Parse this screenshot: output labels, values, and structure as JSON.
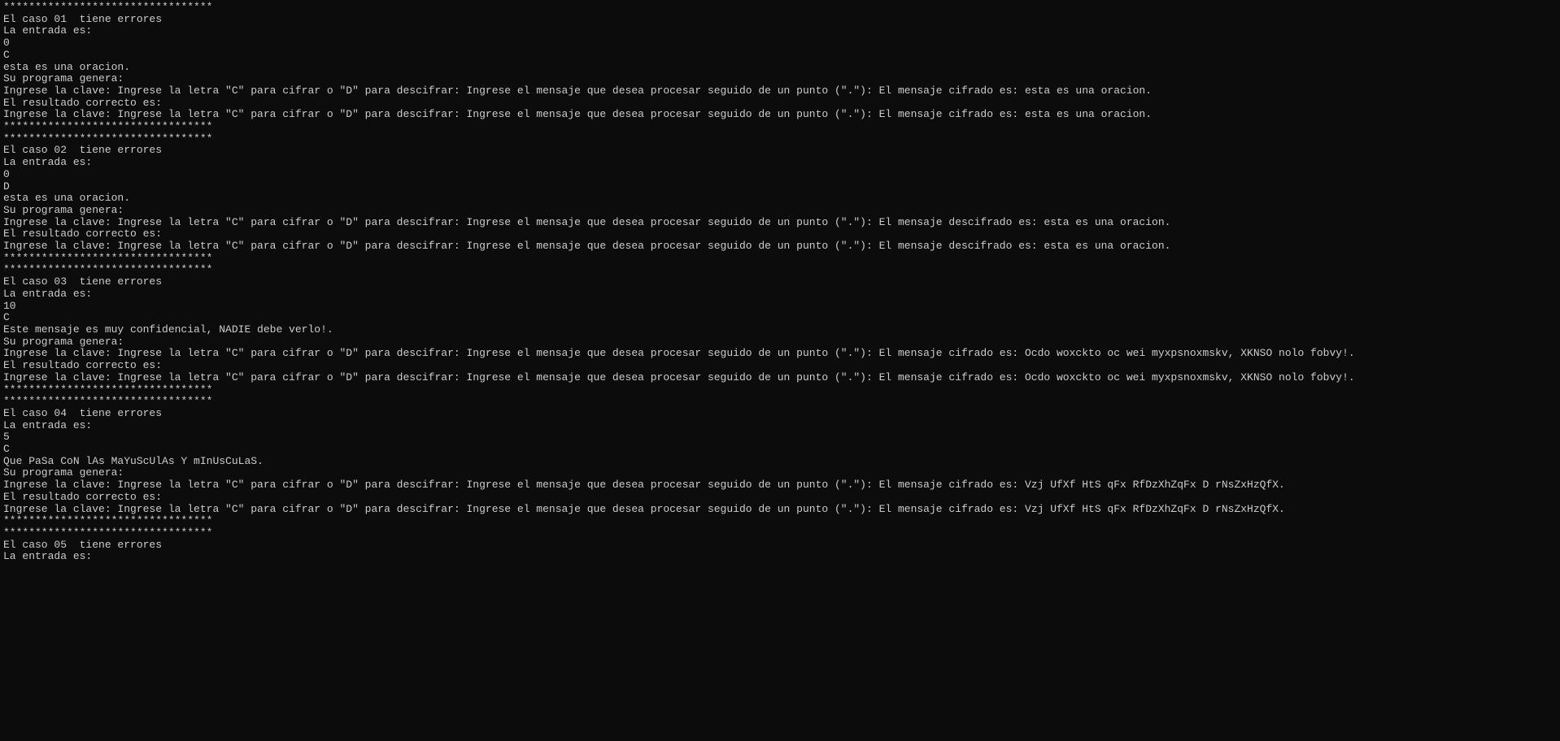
{
  "separator": "*********************************",
  "labels": {
    "caso_prefix": "El caso ",
    "caso_suffix": "  tiene errores",
    "entrada": "La entrada es:",
    "programa_genera": "Su programa genera:",
    "resultado_correcto": "El resultado correcto es:",
    "prompt_prefix": "Ingrese la clave: Ingrese la letra \"C\" para cifrar o \"D\" para descifrar: Ingrese el mensaje que desea procesar seguido de un punto (\".\"): El mensaje ",
    "cifrado": "cifrado es: ",
    "descifrado": "descifrado es: "
  },
  "cases": [
    {
      "num": "01",
      "input": [
        "0",
        "C",
        "esta es una oracion."
      ],
      "mode": "cifrado",
      "output": "esta es una oracion.",
      "expected": "esta es una oracion."
    },
    {
      "num": "02",
      "input": [
        "0",
        "D",
        "esta es una oracion."
      ],
      "mode": "descifrado",
      "output": "esta es una oracion.",
      "expected": "esta es una oracion."
    },
    {
      "num": "03",
      "input": [
        "10",
        "C",
        "Este mensaje es muy confidencial, NADIE debe verlo!."
      ],
      "mode": "cifrado",
      "output": "Ocdo woxckto oc wei myxpsnoxmskv, XKNSO nolo fobvy!.",
      "expected": "Ocdo woxckto oc wei myxpsnoxmskv, XKNSO nolo fobvy!."
    },
    {
      "num": "04",
      "input": [
        "5",
        "C",
        "Que PaSa CoN lAs MaYuScUlAs Y mInUsCuLaS."
      ],
      "mode": "cifrado",
      "output": "Vzj UfXf HtS qFx RfDzXhZqFx D rNsZxHzQfX.",
      "expected": "Vzj UfXf HtS qFx RfDzXhZqFx D rNsZxHzQfX."
    },
    {
      "num": "05",
      "input": [],
      "mode": "",
      "output": "",
      "expected": "",
      "partial": true
    }
  ]
}
